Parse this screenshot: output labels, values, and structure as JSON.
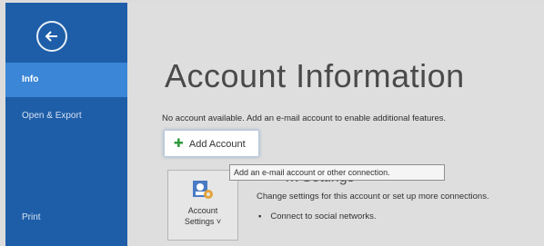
{
  "sidebar": {
    "back_icon": "arrow-left-icon",
    "items": [
      {
        "label": "Info",
        "active": true
      },
      {
        "label": "Open & Export",
        "active": false
      },
      {
        "label": "",
        "active": false
      },
      {
        "label": "Print",
        "active": false
      }
    ]
  },
  "main": {
    "title": "Account Information",
    "notice": "No account available. Add an e-mail account to enable additional features.",
    "add_account_label": "Add Account",
    "tooltip": "Add an e-mail account or other connection.",
    "section_heading": "rk Settings",
    "account_settings": {
      "line1": "Account",
      "line2": "Settings ˅"
    },
    "description": "Change settings for this account or set up more connections.",
    "bullet": "Connect to social networks."
  },
  "colors": {
    "sidebar_bg": "#1e5ea8",
    "active_item_bg": "#3b86d6",
    "main_bg": "#dedede"
  }
}
